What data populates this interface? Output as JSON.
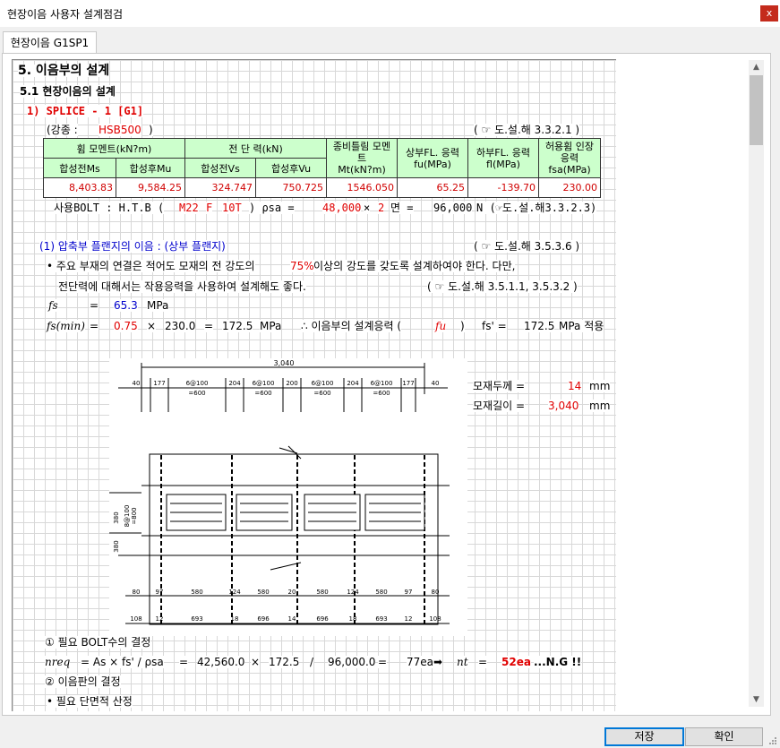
{
  "window": {
    "title": "현장이음 사용자 설계점검",
    "close_label": "x"
  },
  "tab": {
    "label": "현장이음 G1SP1"
  },
  "doc": {
    "section": "5. 이음부의 설계",
    "subsection": "5.1 현장이음의 설계",
    "splice_title": "1) SPLICE - 1  [G1]",
    "steel_prefix": "(강종 :",
    "steel_grade": "HSB500",
    "steel_suffix": ")",
    "ref_top": "( ☞ 도.설.해 3.3.2.1 )",
    "table": {
      "h_moment": "휨 모멘트(kN?m)",
      "h_shear": "전 단 력(kN)",
      "h_torsion": "종비틀림 모멘트",
      "h_torsion_sym": "Mt(kN?m)",
      "h_upper": "상부FL. 응력fu(MPa)",
      "h_lower": "하부FL. 응력fl(MPa)",
      "h_allow": "허용휨 인장응력",
      "h_allow_sym": "fsa(MPa)",
      "h_ms": "합성전Ms",
      "h_mu": "합성후Mu",
      "h_vs": "합성전Vs",
      "h_vu": "합성후Vu",
      "v_ms": "8,403.83",
      "v_mu": "9,584.25",
      "v_vs": "324.747",
      "v_vu": "750.725",
      "v_mt": "1546.050",
      "v_fu": "65.25",
      "v_fl": "-139.70",
      "v_fsa": "230.00"
    },
    "bolt": {
      "label": "사용BOLT  :  H.T.B  (",
      "size": "M22",
      "f": "F",
      "grade": "10T",
      "rho": ")    ρsa  =",
      "rho_val": "48,000",
      "times": "×",
      "n": "2",
      "unit": "면  =",
      "result": "96,000",
      "result_unit": "N   (☞도.설.해3.3.2.3)"
    },
    "sub1": {
      "title": "(1) 압축부 플랜지의 이음  : (상부 플랜지)",
      "ref": "( ☞ 도.설.해 3.5.3.6 )",
      "para1_a": "•  주요 부재의 연결은 적어도 모재의 전 강도의",
      "para1_pct": "75%",
      "para1_b": "이상의 강도를 갖도록 설계하여야 한다. 다만,",
      "para2": "전단력에 대해서는 작용응력을 사용하여 설계해도 좋다.",
      "para2_ref": "( ☞ 도.설.해 3.5.1.1, 3.5.3.2 )",
      "fs_label": "fs",
      "fs_eq": "=",
      "fs_val": "65.3",
      "fs_unit": "MPa",
      "fsmin_label": "fs(min)",
      "fsmin_eq": "=",
      "fsmin_factor": "0.75",
      "fsmin_times": "×",
      "fsmin_base": "230.0",
      "fsmin_eq2": "=",
      "fsmin_val": "172.5",
      "fsmin_unit": "MPa",
      "design_text": "∴ 이음부의 설계응력   (",
      "fu_sym": "fu",
      "design_close": ")",
      "fs_prime": "fs' =",
      "fs_prime_val": "172.5",
      "fs_prime_unit": "MPa 적용"
    },
    "base_plate": {
      "thk_label": "모재두께 =",
      "thk_val": "14",
      "thk_unit": "mm",
      "len_label": "모재길이 =",
      "len_val": "3,040",
      "len_unit": "mm"
    },
    "drawing": {
      "total": "3,040",
      "top_dims": [
        "40",
        "177",
        "6@100",
        "204",
        "6@100",
        "200",
        "6@100",
        "204",
        "6@100",
        "177",
        "40"
      ],
      "top_sub": [
        "=600",
        "=600",
        "=600",
        "=600"
      ],
      "bottom_dims1": [
        "80",
        "97",
        "580",
        "124",
        "580",
        "20",
        "580",
        "124",
        "580",
        "97",
        "80"
      ],
      "bottom_dims2": [
        "108",
        "12",
        "693",
        "18",
        "696",
        "14",
        "696",
        "18",
        "693",
        "12",
        "108"
      ],
      "left_dims": [
        "380",
        "8@100",
        "=800",
        "380"
      ]
    },
    "step1": {
      "title": "① 필요 BOLT수의 결정",
      "nreq": "nreq",
      "formula": "= As × fs' / ρsa",
      "eq": "=",
      "area": "42,560.0",
      "times": "×",
      "stress": "172.5",
      "div": "/",
      "cap": "96,000.0",
      "eq2": "=",
      "result": "77ea",
      "arrow": "➡",
      "nt": "nt",
      "nt_eq": "=",
      "nt_val": "52ea",
      "ng": "...N.G !!"
    },
    "step2": {
      "title": "② 이음판의 결정",
      "bullet": "•  필요 단면적 산정"
    }
  },
  "buttons": {
    "save": "저장",
    "confirm": "확인"
  },
  "colors": {
    "accent": "#0078d7",
    "red": "#e00000",
    "header_green": "#ccffcc",
    "close": "#c42b1c"
  }
}
